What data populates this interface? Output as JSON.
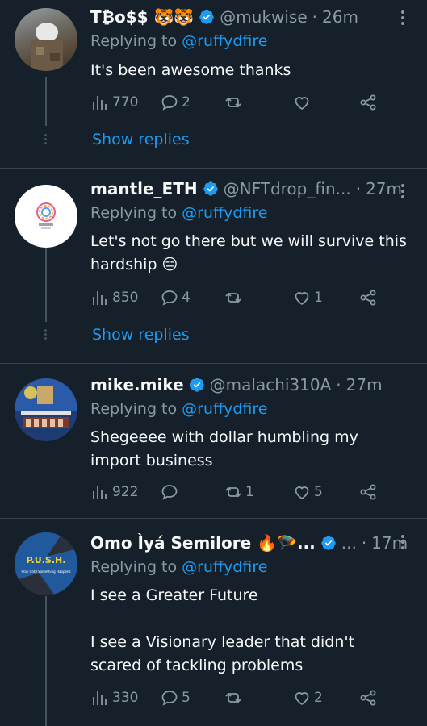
{
  "tweets": [
    {
      "name": "T₿o$$ 🐯🐯",
      "handle": "@mukwise",
      "time": "26m",
      "replying_label": "Replying to",
      "replying_to": "@ruffydfire",
      "text_lines": [
        "It's been awesome thanks"
      ],
      "views": "770",
      "replies": "2",
      "retweets": "",
      "likes": "",
      "show_replies": "Show replies"
    },
    {
      "name": "mantle_ETH",
      "handle": "@NFTdrop_fin...",
      "time": "27m",
      "replying_label": "Replying to",
      "replying_to": "@ruffydfire",
      "text_lines": [
        "Let's not go there but we will survive this",
        "hardship 😑"
      ],
      "views": "850",
      "replies": "4",
      "retweets": "",
      "likes": "1",
      "show_replies": "Show replies"
    },
    {
      "name": "mike.mike",
      "handle": "@malachi310A",
      "time": "27m",
      "replying_label": "Replying to",
      "replying_to": "@ruffydfire",
      "text_lines": [
        "Shegeeee with dollar humbling my",
        "import business"
      ],
      "views": "922",
      "replies": "",
      "retweets": "1",
      "likes": "5"
    },
    {
      "name": "Omo Ìyá Semilore 🔥🪂...",
      "handle": "...",
      "time": "17m",
      "replying_label": "Replying to",
      "replying_to": "@ruffydfire",
      "text_lines": [
        "I see a Greater Future",
        "",
        "I see a Visionary leader that didn't",
        "scared of tackling problems"
      ],
      "views": "330",
      "replies": "5",
      "retweets": "",
      "likes": "2",
      "avatar_text": "P.U.S.H.",
      "avatar_subtext": "Pray Until Something Happens"
    }
  ],
  "colors": {
    "background": "#15202b",
    "accent": "#1d9bf0",
    "muted": "#8b98a5",
    "verified": "#1d9bf0"
  }
}
